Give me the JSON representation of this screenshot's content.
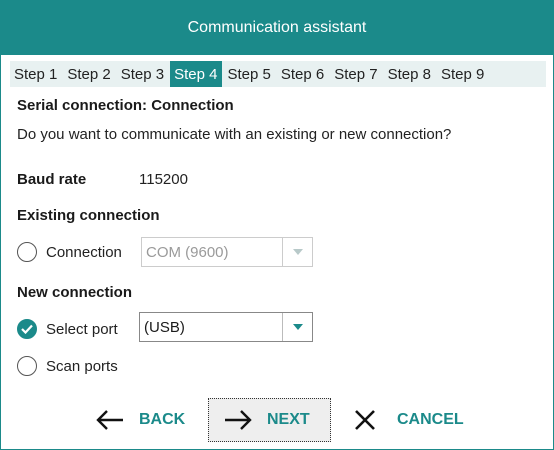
{
  "window": {
    "title": "Communication assistant"
  },
  "steps": [
    "Step 1",
    "Step 2",
    "Step 3",
    "Step 4",
    "Step 5",
    "Step 6",
    "Step 7",
    "Step 8",
    "Step 9"
  ],
  "active_step_index": 3,
  "section": {
    "title": "Serial connection: Connection",
    "question": "Do you want to communicate with an existing or new connection?"
  },
  "baud": {
    "label": "Baud rate",
    "value": "115200"
  },
  "existing": {
    "heading": "Existing connection",
    "radio_label": "Connection",
    "selected": false,
    "combo_value": "COM (9600)",
    "combo_enabled": false
  },
  "new_connection": {
    "heading": "New connection",
    "select_port_label": "Select port",
    "select_port_selected": true,
    "port_value": "(USB)",
    "scan_ports_label": "Scan ports",
    "scan_ports_selected": false
  },
  "nav": {
    "back": "BACK",
    "next": "NEXT",
    "cancel": "CANCEL"
  },
  "colors": {
    "accent": "#1b8a8a",
    "step_bar": "#e8f1f1"
  },
  "icons": {
    "back": "arrow-left-icon",
    "next": "arrow-right-icon",
    "cancel": "close-icon",
    "dropdown": "chevron-down-icon",
    "check": "checkmark-icon"
  }
}
